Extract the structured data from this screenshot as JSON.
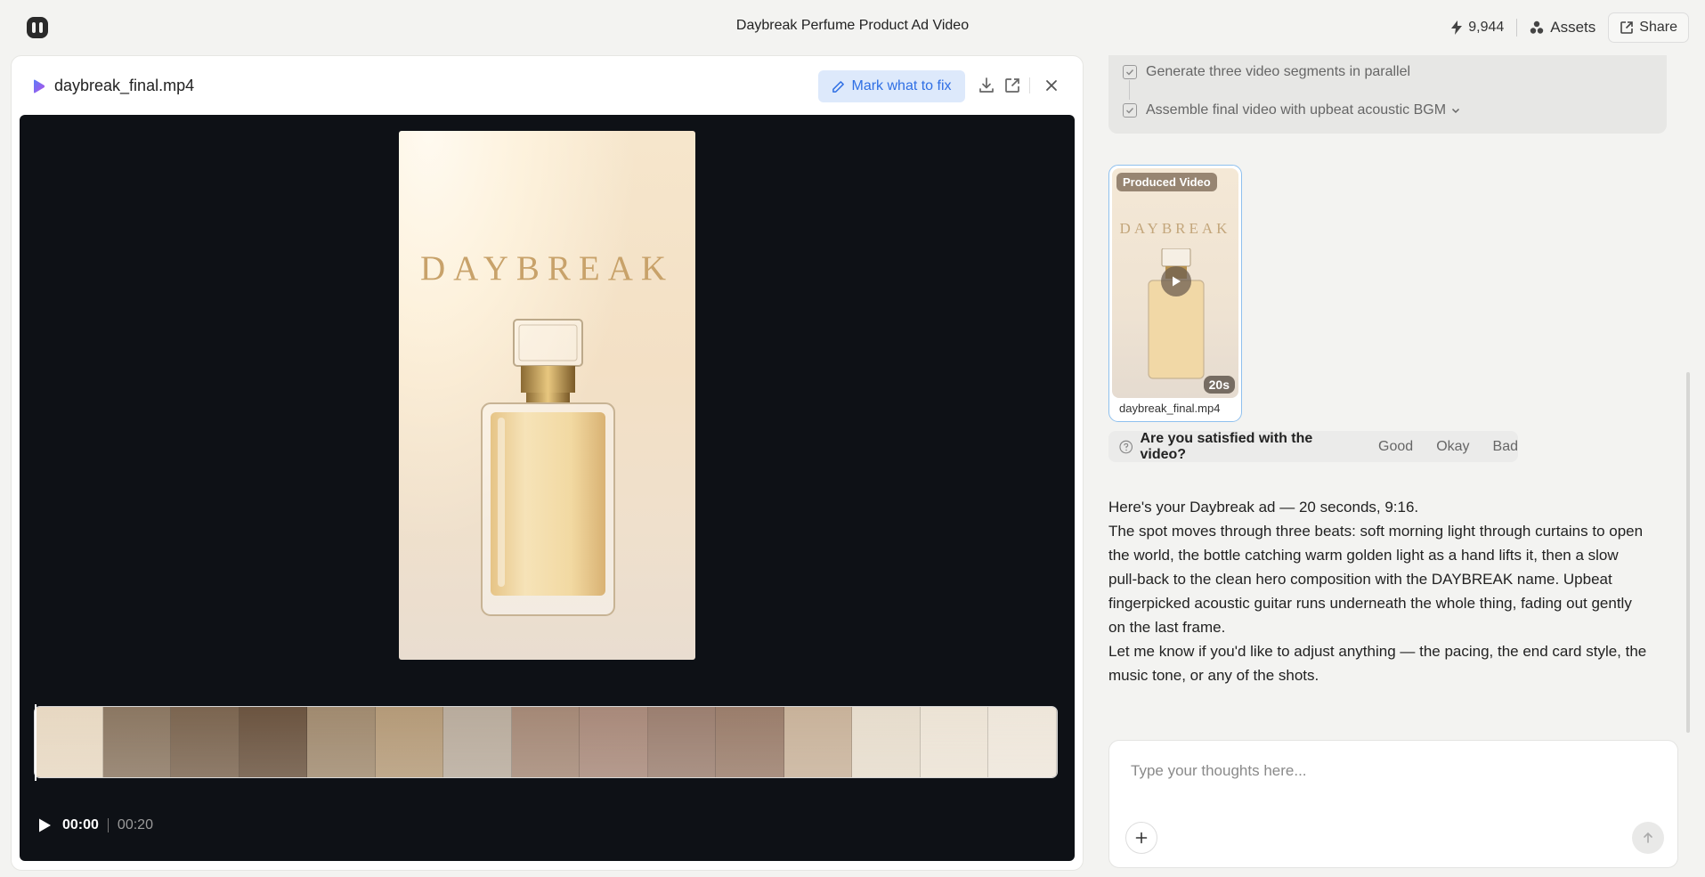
{
  "header": {
    "title": "Daybreak Perfume Product Ad Video",
    "credits": "9,944",
    "assets_label": "Assets",
    "share_label": "Share"
  },
  "viewer": {
    "file_name": "daybreak_final.mp4",
    "mark_label": "Mark what to fix",
    "frame_brand": "DAYBREAK",
    "time_current": "00:00",
    "time_total": "00:20"
  },
  "steps": [
    {
      "label": "Generate three video segments in parallel"
    },
    {
      "label": "Assemble final video with upbeat acoustic BGM"
    }
  ],
  "video_card": {
    "badge": "Produced Video",
    "brand": "DAYBREAK",
    "duration": "20s",
    "file_name": "daybreak_final.mp4"
  },
  "satisfaction": {
    "question": "Are you satisfied with the video?",
    "options": [
      "Good",
      "Okay",
      "Bad"
    ]
  },
  "reply": {
    "p1": "Here's your Daybreak ad — 20 seconds, 9:16.",
    "p2": "The spot moves through three beats: soft morning light through curtains to open the world, the bottle catching warm golden light as a hand lifts it, then a slow pull-back to the clean hero composition with the DAYBREAK name. Upbeat fingerpicked acoustic guitar runs underneath the whole thing, fading out gently on the last frame.",
    "p3": "Let me know if you'd like to adjust anything — the pacing, the end card style, the music tone, or any of the shots."
  },
  "composer": {
    "placeholder": "Type your thoughts here..."
  },
  "colors": {
    "accent": "#2f6fe4",
    "player_bg": "#0e1116",
    "brand_gold": "#c8a26a"
  },
  "timeline_thumbs": [
    "#e7d8c2",
    "#8b7762",
    "#7b6550",
    "#6b5440",
    "#a08a6f",
    "#b49a78",
    "#b8ab9c",
    "#a48876",
    "#a8897a",
    "#9b7f70",
    "#9a7d6b",
    "#c8b29a",
    "#e6dccc",
    "#ece3d5",
    "#eee6da"
  ]
}
